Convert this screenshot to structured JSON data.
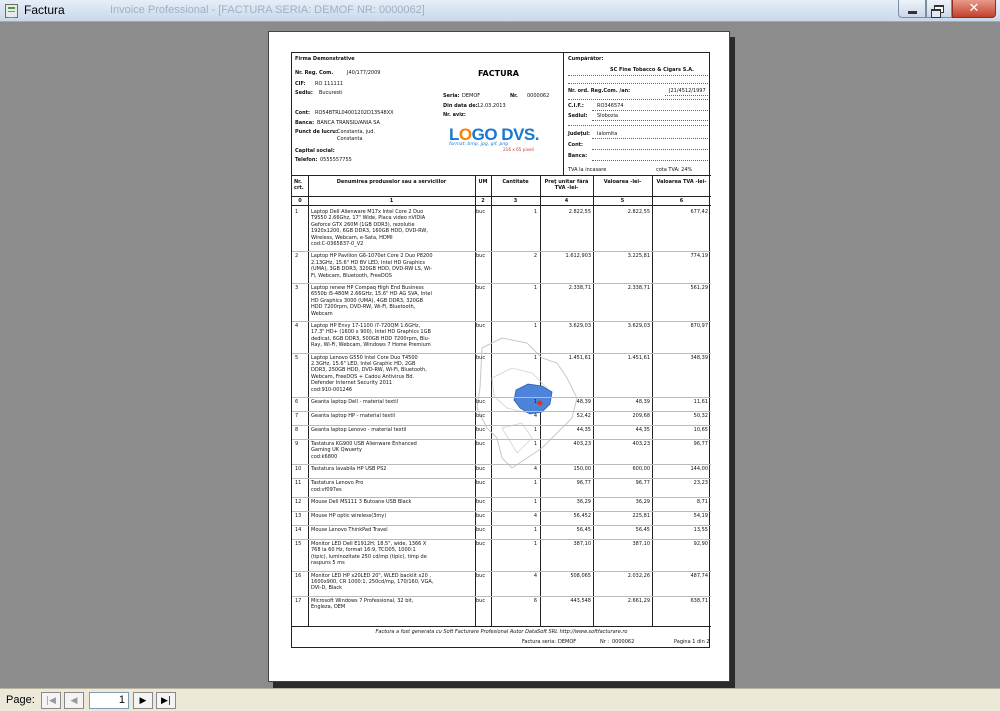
{
  "window": {
    "title": "Factura",
    "ghost_title": "Invoice Professional - [FACTURA SERIA: DEMOF NR: 0000062]"
  },
  "company": {
    "name": "Firma Demonstrative",
    "reg_com_label": "Nr. Reg. Com.",
    "reg_com": "J40/177/2009",
    "cif_label": "CIF:",
    "cif": "RO 111111",
    "sediu_label": "Sediu:",
    "sediu": "Bucuresti",
    "cont_label": "Cont:",
    "cont": "RO54BTRL04001202D13548XX",
    "banca_label": "Banca:",
    "banca": "BANCA TRANSILVANIA SA",
    "punct_label": "Punct de lucru:",
    "punct_line1": "Constanta, jud.",
    "punct_line2": "Constanta",
    "capital_label": "Capital social:",
    "telefon_label": "Telefon:",
    "telefon": "0555557755"
  },
  "invoice": {
    "title": "FACTURA",
    "serie_label": "Seria:",
    "serie": "DEMOF",
    "nr_label": "Nr.",
    "nr": "0000062",
    "data_label": "Din data de:",
    "data": "12.03.2013",
    "aviz_label": "Nr. aviz:"
  },
  "logo": {
    "text_a": "L",
    "text_o": "O",
    "text_b": "GO DVS.",
    "subtitle": "format: bmp, jpg, gif, png",
    "size": "216 x 65 pixeli"
  },
  "buyer": {
    "title": "Cumpărător:",
    "name": "SC Fine Tobacco & Cigars S.A.",
    "reg_com_label": "Nr. ord. Reg.Com. /an:",
    "reg_com": "J21/4512/1997",
    "cif_label": "C.I.F.:",
    "cif": "RO346574",
    "sediu_label": "Sediul:",
    "sediu": "Slobozia",
    "judet_label": "Judeţul:",
    "judet": "Ialomita",
    "cont_label": "Cont:",
    "banca_label": "Banca:",
    "tva_incasare": "TVA la incasare",
    "cota_tva": "cota TVA: 24%"
  },
  "table": {
    "headers": [
      "Nr. crt.",
      "Denumirea produselor sau a serviciilor",
      "UM",
      "Cantitate",
      "Preţ unitar fără TVA -lei-",
      "Valoarea -lei-",
      "Valoarea TVA -lei-"
    ],
    "col_numbers": [
      "0",
      "1",
      "2",
      "3",
      "4",
      "5",
      "6"
    ],
    "rows": [
      {
        "nr": "1",
        "desc": [
          "Laptop Dell Alienware M17x Intel Core 2 Duo",
          "T9550 2.66Ghz, 17\" Wide, Placa video nVIDIA",
          "Geforce GTX 260M (1GB DDR3), rezolutie",
          "1920x1200, 6GB DDR3, 160GB HDD, DVD-RW,",
          "Wireless, Webcam, e-Sata, HDMI",
          "cod:C-0365837-0_V2"
        ],
        "um": "buc",
        "qty": "1",
        "price": "2.822,55",
        "value": "2.822,55",
        "vat": "677,42"
      },
      {
        "nr": "2",
        "desc": [
          "Laptop HP Pavilion G6-1070et Core 2 Duo P8200",
          "2.13GHz, 15.6\" HD BV LED, Intel HD Graphics",
          "(UMA), 3GB DDR3, 320GB HDD, DVD-RW LS, Wi-",
          "Fi, Webcam, Bluetooth, FreeDOS"
        ],
        "um": "buc",
        "qty": "2",
        "price": "1.612,903",
        "value": "3.225,81",
        "vat": "774,19"
      },
      {
        "nr": "3",
        "desc": [
          "Laptop renew HP Compaq High End Business",
          "6550b i5-480M 2.66GHz, 15.6\" HD AG SVA, Intel",
          "HD Graphics 3000 (UMA), 4GB DDR3, 320GB",
          "HDD 7200rpm, DVD-RW, Wi-Fi, Bluetooth,",
          "Webcam"
        ],
        "um": "buc",
        "qty": "1",
        "price": "2.338,71",
        "value": "2.338,71",
        "vat": "561,29"
      },
      {
        "nr": "4",
        "desc": [
          "Laptop HP Envy 17-1100 i7-720QM 1.6GHz,",
          "17.3\" HD+ (1600 x 900), Intel HD Graphics 1GB",
          "dedicat, 6GB DDR3, 500GB HDD 7200rpm, Blu-",
          "Ray, Wi-Fi, Webcam, Windows 7 Home Premium"
        ],
        "um": "buc",
        "qty": "1",
        "price": "3.629,03",
        "value": "3.629,03",
        "vat": "870,97"
      },
      {
        "nr": "5",
        "desc": [
          "Laptop Lenovo G550 Intel Core Duo T4500",
          "2.3GHz, 15.6\" LED, Intel Graphic HD, 2GB",
          "DDR3, 250GB HDD, DVD-RW, Wi-Fi, Bluetooth,",
          "Webcam, FreeDOS + Cadou Antivirus Bd.",
          "Defender Internet Security 2011",
          "cod:910-001246"
        ],
        "um": "buc",
        "qty": "1",
        "price": "1.451,61",
        "value": "1.451,61",
        "vat": "348,39"
      },
      {
        "nr": "6",
        "desc": [
          "Geanta laptop Dell - material textil"
        ],
        "um": "buc",
        "qty": "1",
        "price": "48,39",
        "value": "48,39",
        "vat": "11,61"
      },
      {
        "nr": "7",
        "desc": [
          "Geanta laptop HP - material textil"
        ],
        "um": "buc",
        "qty": "4",
        "price": "52,42",
        "value": "209,68",
        "vat": "50,32"
      },
      {
        "nr": "8",
        "desc": [
          "Geanta laptop Lenovo - material textil"
        ],
        "um": "buc",
        "qty": "1",
        "price": "44,35",
        "value": "44,35",
        "vat": "10,65"
      },
      {
        "nr": "9",
        "desc": [
          "Tastatura KG900 USB Alienware Enhanced",
          "Gaming UK Qwuerty",
          "cod:k6800"
        ],
        "um": "buc",
        "qty": "1",
        "price": "403,23",
        "value": "403,23",
        "vat": "96,77"
      },
      {
        "nr": "10",
        "desc": [
          "Tastatura lavabila HP USB PS2"
        ],
        "um": "buc",
        "qty": "4",
        "price": "150,00",
        "value": "600,00",
        "vat": "144,00"
      },
      {
        "nr": "11",
        "desc": [
          "Tastatura Lenovo Pro",
          "cod:vf097es"
        ],
        "um": "buc",
        "qty": "1",
        "price": "96,77",
        "value": "96,77",
        "vat": "23,23"
      },
      {
        "nr": "12",
        "desc": [
          "Mouse Dell MS111 3 Butoane USB Black"
        ],
        "um": "buc",
        "qty": "1",
        "price": "36,29",
        "value": "36,29",
        "vat": "8,71"
      },
      {
        "nr": "13",
        "desc": [
          "Mouse HP optic wireless(3my)"
        ],
        "um": "buc",
        "qty": "4",
        "price": "56,452",
        "value": "225,81",
        "vat": "54,19"
      },
      {
        "nr": "14",
        "desc": [
          "Mouse Lenovo ThinkPad Travel"
        ],
        "um": "buc",
        "qty": "1",
        "price": "56,45",
        "value": "56,45",
        "vat": "13,55"
      },
      {
        "nr": "15",
        "desc": [
          "Monitor LED Dell E1912H, 18.5\", wide, 1366 X",
          "768 la 60 Hz, format 16:9, TCO05, 1000:1",
          "(tipic), luminozitate 250 cd/mp (tipic), timp de",
          "raspuns 5 ms"
        ],
        "um": "buc",
        "qty": "1",
        "price": "387,10",
        "value": "387,10",
        "vat": "92,90"
      },
      {
        "nr": "16",
        "desc": [
          "Monitor LED HP x20LED 20\", WLED backlit x20 ,",
          "1600x900, CR 1000:1, 250cd/mp, 170/160, VGA,",
          "DVI-D, Black"
        ],
        "um": "buc",
        "qty": "4",
        "price": "508,065",
        "value": "2.032,26",
        "vat": "487,74"
      },
      {
        "nr": "17",
        "desc": [
          "Microsoft Windows 7 Professional, 32 bit,",
          "Engleza, OEM"
        ],
        "um": "buc",
        "qty": "6",
        "price": "443,548",
        "value": "2.661,29",
        "vat": "638,71"
      }
    ]
  },
  "footer": {
    "generated": "Factura a fost generata cu Soft Facturare Profesional Autor DataSoft SRL http://www.softfacturare.ro",
    "serie_label": "Factura seria:",
    "serie": "DEMOF",
    "nr_label": "Nr :",
    "nr": "0000062",
    "pagina": "Pagina 1 din 2"
  },
  "navigator": {
    "label": "Page:",
    "page": "1"
  }
}
